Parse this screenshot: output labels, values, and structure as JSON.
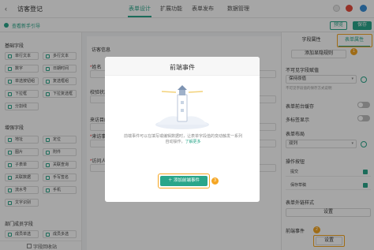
{
  "topbar": {
    "back_glyph": "‹",
    "app_title": "访客登记",
    "tabs": [
      "表单设计",
      "扩展功能",
      "表单发布",
      "数据管理"
    ],
    "active_tab": "表单设计"
  },
  "subbar": {
    "guide_link": "查看新手引导",
    "preview_label": "预览",
    "save_label": "保存"
  },
  "left_panel": {
    "basic_title": "基础字段",
    "basic_fields": [
      "单行文本",
      "多行文本",
      "数字",
      "日期时间",
      "单选按钮组",
      "复选框组",
      "下拉框",
      "下拉复选框",
      "分割线"
    ],
    "enhanced_title": "增强字段",
    "enhanced_fields": [
      "地址",
      "定位",
      "图片",
      "附件",
      "子表单",
      "关联查询",
      "关联数据",
      "手写签名",
      "流水号",
      "手机",
      "文字识别"
    ],
    "dept_title": "部门成员字段",
    "dept_fields": [
      "成员单选",
      "成员多选"
    ],
    "recycle_label": "字段回收站"
  },
  "canvas": {
    "form_title": "访客信息",
    "fields": [
      {
        "label": "姓名",
        "required": true
      },
      {
        "label": "校验状态",
        "required": false
      },
      {
        "label": "来访目的",
        "required": false
      },
      {
        "label": "来访事由",
        "required": true
      },
      {
        "label": "访问人员",
        "required": true
      }
    ]
  },
  "right_panel": {
    "tab_field": "字段属性",
    "tab_form": "表单属性",
    "add_rule_label": "添加显隐规则",
    "invisible_value_label": "不可见字段赋值",
    "invisible_value_select": "保持原值",
    "invisible_note": "不可见字段值的保存方式说明",
    "draft_label": "表单前台缓存",
    "multi_tab_label": "多标签显示",
    "layout_label": "表单布局",
    "layout_select": "双列",
    "op_label": "操作按钮",
    "op_rows": [
      "提交",
      "保存草稿"
    ],
    "ext_style_label": "表单外链样式",
    "ext_style_btn": "设置",
    "frontend_event_label": "前端事件",
    "frontend_event_btn": "设置"
  },
  "modal": {
    "title": "前端事件",
    "desc": "前端事件可以在填写或编辑数据时，让表单字段值的变动触发一系列自动操作，",
    "desc_link": "了解更多",
    "add_label": "添加前端事件",
    "add_icon": "plus-icon"
  },
  "badges": [
    "1",
    "2",
    "3"
  ],
  "colors": {
    "accent": "#2aa68a",
    "highlight": "#f5a623"
  }
}
